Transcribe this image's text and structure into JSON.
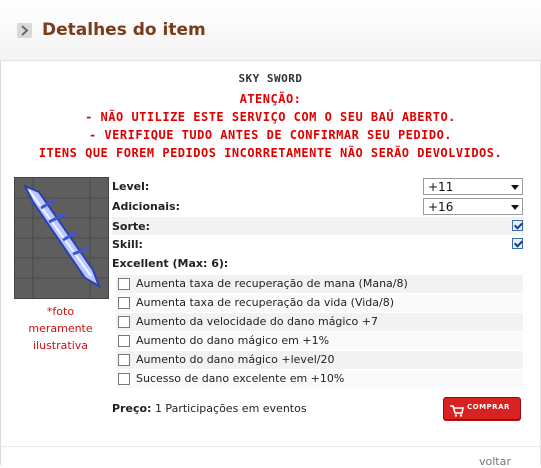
{
  "header": {
    "title": "Detalhes do item"
  },
  "item": {
    "name": "SKY SWORD"
  },
  "warnings": {
    "title": "ATENÇÃO:",
    "line1": "- NÃO UTILIZE ESTE SERVIÇO COM O SEU BAÚ ABERTO.",
    "line2": "- VERIFIQUE TUDO ANTES DE CONFIRMAR SEU PEDIDO.",
    "line3": "ITENS QUE FOREM PEDIDOS INCORRETAMENTE NÃO SERÃO DEVOLVIDOS."
  },
  "image": {
    "caption_line1": "*foto",
    "caption_line2": "meramente",
    "caption_line3": "ilustrativa"
  },
  "form": {
    "level_label": "Level:",
    "level_value": "+11",
    "adicionais_label": "Adicionais:",
    "adicionais_value": "+16",
    "sorte_label": "Sorte:",
    "sorte_checked": true,
    "skill_label": "Skill:",
    "skill_checked": true,
    "excellent_label": "Excellent (Max: 6):",
    "excellent_options": [
      "Aumenta taxa de recuperação de mana (Mana/8)",
      "Aumenta taxa de recuperação da vida (Vida/8)",
      "Aumento da velocidade do dano mágico +7",
      "Aumento do dano mágico em +1%",
      "Aumento do dano mágico +level/20",
      "Sucesso de dano excelente em +10%"
    ]
  },
  "price": {
    "label": "Preço:",
    "value": "1 Participações em eventos"
  },
  "buttons": {
    "buy": "COMPRAR",
    "back": "voltar"
  },
  "colors": {
    "title": "#7a3b1b",
    "warning": "#e00000",
    "buy_button": "#d82121"
  }
}
